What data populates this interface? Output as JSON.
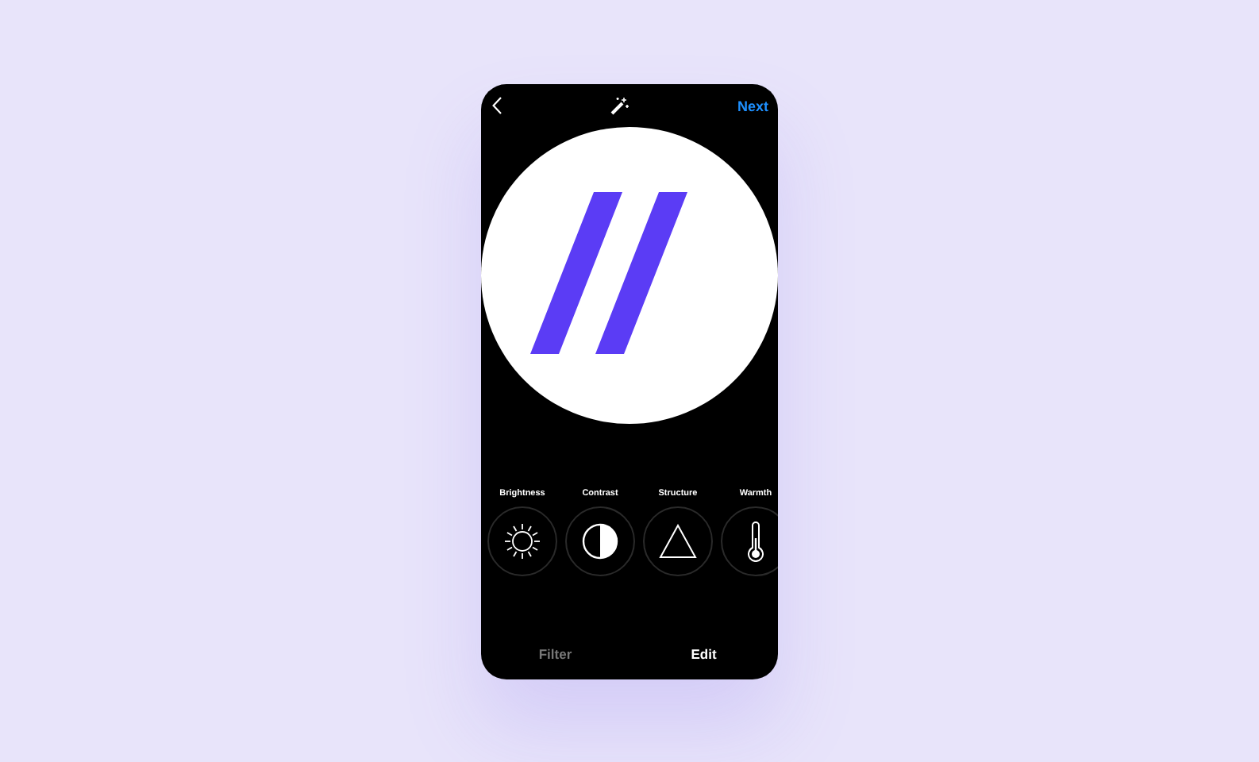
{
  "header": {
    "action": "Next"
  },
  "tools": [
    {
      "label": "Brightness",
      "kind": "sun"
    },
    {
      "label": "Contrast",
      "kind": "contrast"
    },
    {
      "label": "Structure",
      "kind": "triangle"
    },
    {
      "label": "Warmth",
      "kind": "thermometer"
    }
  ],
  "tabs": [
    {
      "label": "Filter",
      "selected": false
    },
    {
      "label": "Edit",
      "selected": true
    }
  ]
}
